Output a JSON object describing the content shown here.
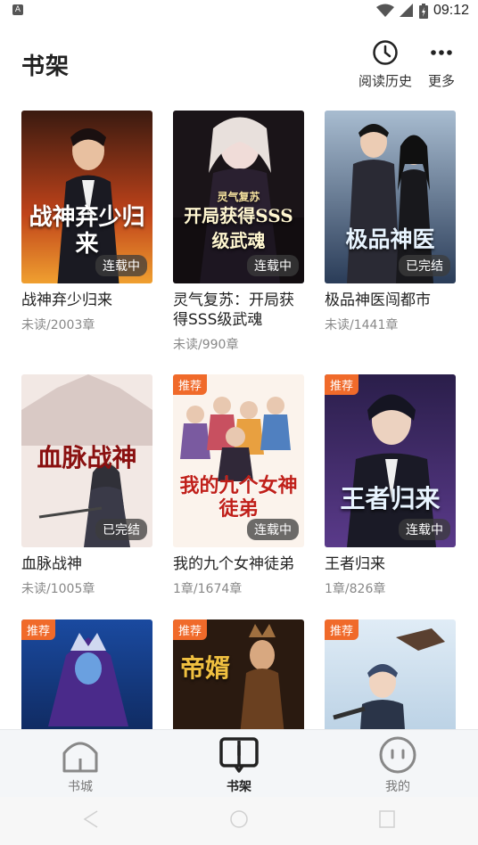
{
  "status_bar": {
    "time": "09:12",
    "left_icon": "A",
    "icons": [
      "wifi-icon",
      "signal-icon",
      "battery-icon"
    ]
  },
  "header": {
    "title": "书架",
    "history_label": "阅读历史",
    "more_label": "更多"
  },
  "books": [
    {
      "title": "战神弃少归来",
      "progress": "未读/2003章",
      "status": "连载中",
      "recommended": false,
      "cover_text": "战神弃少归来"
    },
    {
      "title": "灵气复苏：开局获得SSS级武魂",
      "progress": "未读/990章",
      "status": "连载中",
      "recommended": false,
      "cover_text": "开局获得SSS级武魂",
      "cover_subtext": "灵气复苏"
    },
    {
      "title": "极品神医闯都市",
      "progress": "未读/1441章",
      "status": "已完结",
      "recommended": false,
      "cover_text": "极品神医"
    },
    {
      "title": "血脉战神",
      "progress": "未读/1005章",
      "status": "已完结",
      "recommended": false,
      "cover_text": "血脉战神"
    },
    {
      "title": "我的九个女神徒弟",
      "progress": "1章/1674章",
      "status": "连载中",
      "recommended": true,
      "cover_text": "我的九个女神徒弟"
    },
    {
      "title": "王者归来",
      "progress": "1章/826章",
      "status": "连载中",
      "recommended": true,
      "cover_text": "王者归来"
    },
    {
      "title": "",
      "progress": "",
      "status": "",
      "recommended": true
    },
    {
      "title": "",
      "progress": "",
      "status": "",
      "recommended": true,
      "cover_text": "帝婿"
    },
    {
      "title": "",
      "progress": "",
      "status": "",
      "recommended": true
    }
  ],
  "recommend_badge": "推荐",
  "tabs": [
    {
      "label": "书城",
      "icon": "home-icon",
      "active": false
    },
    {
      "label": "书架",
      "icon": "book-icon",
      "active": true
    },
    {
      "label": "我的",
      "icon": "profile-icon",
      "active": false
    }
  ],
  "colors": {
    "accent": "#f06a2a",
    "title_text": "#222222",
    "subtle_text": "#888888"
  }
}
